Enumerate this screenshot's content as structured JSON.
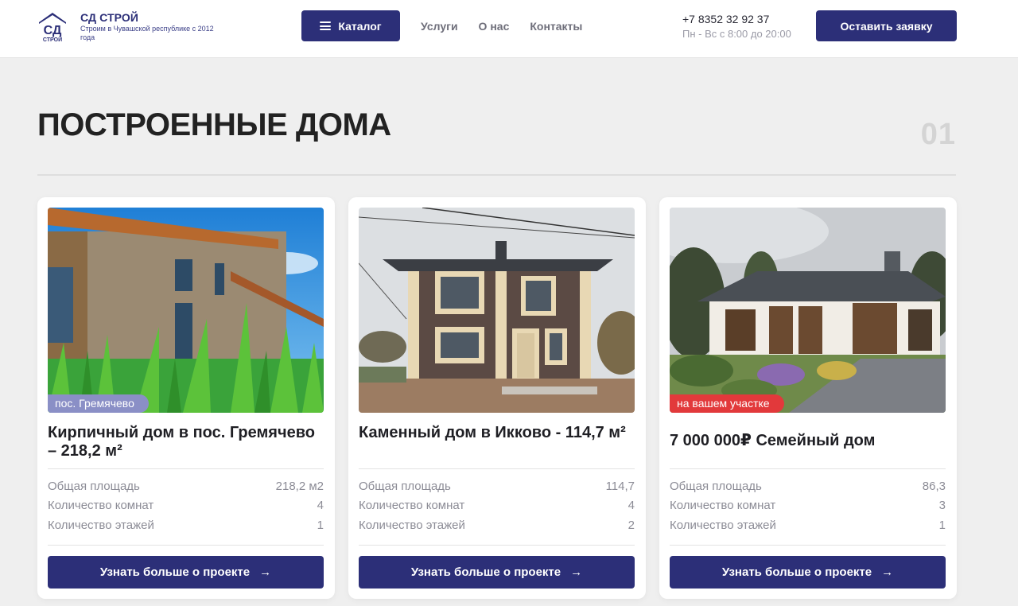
{
  "header": {
    "brand_name": "СД СТРОЙ",
    "brand_tagline": "Строим в Чувашской республике с 2012 года",
    "logo_mark_top": "СД",
    "logo_mark_bottom": "СТРОЙ",
    "catalog_label": "Каталог",
    "nav": [
      "Услуги",
      "О нас",
      "Контакты"
    ],
    "phone": "+7 8352 32 92 37",
    "hours": "Пн - Вс с 8:00 до 20:00",
    "request_label": "Оставить заявку"
  },
  "section": {
    "title": "ПОСТРОЕННЫЕ ДОМА",
    "number": "01"
  },
  "spec_labels": {
    "area": "Общая площадь",
    "rooms": "Количество комнат",
    "floors": "Количество этажей"
  },
  "cards": [
    {
      "badge": "пос. Гремячево",
      "badge_color": "#8a8fc6",
      "title": "Кирпичный дом в пос. Гремячево – 218,2 м²",
      "area": "218,2 м2",
      "rooms": "4",
      "floors": "1",
      "button": "Узнать больше о проекте"
    },
    {
      "badge": "",
      "title": "Каменный дом в Икково - 114,7 м²",
      "area": "114,7",
      "rooms": "4",
      "floors": "2",
      "button": "Узнать больше о проекте"
    },
    {
      "badge": "на вашем участке",
      "badge_color": "#e2393b",
      "title": "7 000 000₽ Семейный дом",
      "area": "86,3",
      "rooms": "3",
      "floors": "1",
      "button": "Узнать больше о проекте"
    }
  ],
  "colors": {
    "primary": "#2c2f78",
    "page_bg": "#efefef"
  }
}
